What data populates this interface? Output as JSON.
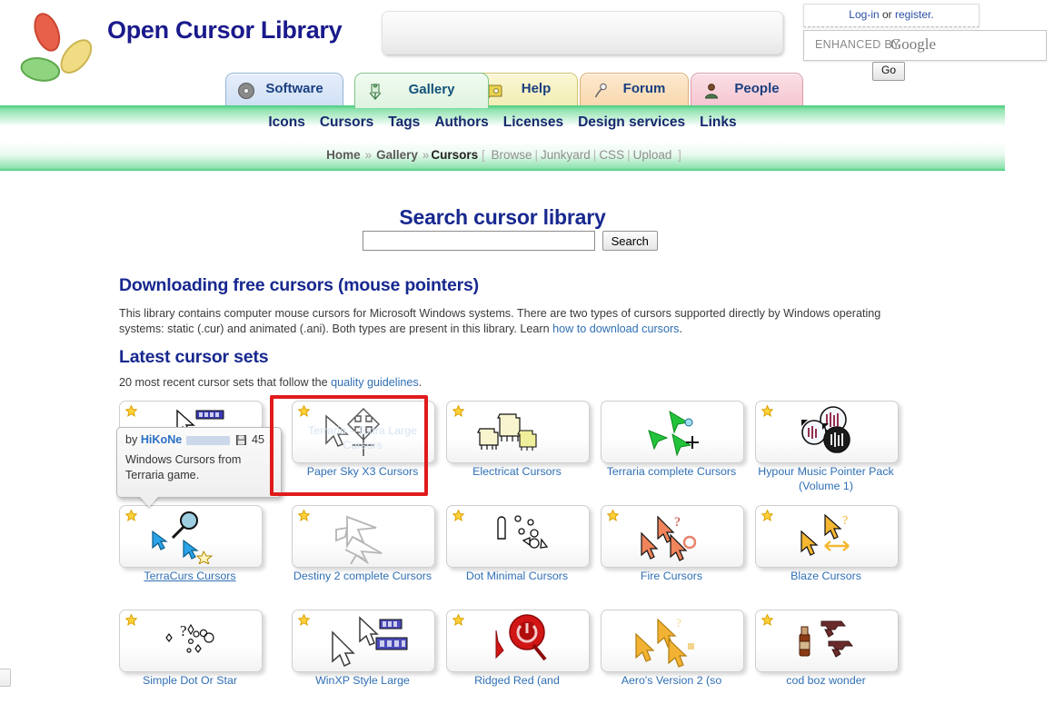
{
  "site": {
    "title": "Open Cursor Library",
    "logo_icon": "three-loop-logo"
  },
  "account": {
    "login_label": "Log-in",
    "or_label": " or ",
    "register_label": "register.",
    "google_enhanced_prefix": "ENHANCED BY",
    "google_brand": "Google",
    "go_label": "Go"
  },
  "tabs": [
    {
      "label": "Software",
      "icon": "disc-icon",
      "active": false
    },
    {
      "label": "Gallery",
      "icon": "easel-icon",
      "active": true
    },
    {
      "label": "Help",
      "icon": "book-icon",
      "active": false
    },
    {
      "label": "Forum",
      "icon": "microphone-icon",
      "active": false
    },
    {
      "label": "People",
      "icon": "person-icon",
      "active": false
    }
  ],
  "nav": [
    "Icons",
    "Cursors",
    "Tags",
    "Authors",
    "Licenses",
    "Design services",
    "Links"
  ],
  "breadcrumb": {
    "home": "Home",
    "gallery": "Gallery",
    "current": "Cursors",
    "open_bracket": "[",
    "close_bracket": "]",
    "pipe": "|",
    "sep": "»",
    "sub": [
      "Browse",
      "Junkyard",
      "CSS",
      "Upload"
    ]
  },
  "search": {
    "heading": "Search cursor library",
    "value": "",
    "placeholder": "",
    "button": "Search"
  },
  "intro": {
    "heading": "Downloading free cursors (mouse pointers)",
    "text_1": "This library contains computer mouse cursors for Microsoft Windows systems. There are two types of cursors supported directly by Windows operating systems: static (.cur) and animated (.ani). Both types are present in this library. Learn ",
    "link": "how to download cursors",
    "text_2": "."
  },
  "latest": {
    "heading": "Latest cursor sets",
    "sub_1": "20 most recent cursor sets that follow the ",
    "sub_link": "quality guidelines",
    "sub_2": "."
  },
  "tooltip": {
    "by_label": "by ",
    "author": "HiKoNe",
    "size": "45",
    "disk_icon": "floppy-disk-icon",
    "description": "Windows Cursors from Terraria game.",
    "ghost_caption": "Terraria – Extra Large Cursors"
  },
  "highlight": {
    "color": "#e01b1b",
    "target": "Paper Sky X3 Cursors"
  },
  "cards": [
    [
      {
        "title": "",
        "starred": true,
        "art": "arrow-and-blue-bar",
        "hover": false
      },
      {
        "title": "Paper Sky X3 Cursors",
        "starred": true,
        "art": "paper-sky",
        "hover": false
      },
      {
        "title": "Electricat Cursors",
        "starred": true,
        "art": "cats",
        "hover": false
      },
      {
        "title": "Terraria complete Cursors",
        "starred": false,
        "art": "green-arrows",
        "hover": false
      },
      {
        "title": "Hypour Music Pointer Pack (Volume 1)",
        "starred": true,
        "art": "music-discs",
        "hover": false
      }
    ],
    [
      {
        "title": "TerraCurs Cursors",
        "starred": true,
        "art": "blue-arrows-magnifier",
        "hover": true
      },
      {
        "title": "Destiny 2 complete Cursors",
        "starred": true,
        "art": "grey-angular",
        "hover": false
      },
      {
        "title": "Dot Minimal Cursors",
        "starred": true,
        "art": "dots",
        "hover": false
      },
      {
        "title": "Fire Cursors",
        "starred": true,
        "art": "orange-arrows",
        "hover": false
      },
      {
        "title": "Blaze Cursors",
        "starred": true,
        "art": "yellow-arrows",
        "hover": false
      }
    ],
    [
      {
        "title": "Simple Dot Or Star",
        "starred": true,
        "art": "stars-dots",
        "hover": false
      },
      {
        "title": "WinXP Style Large",
        "starred": true,
        "art": "winxp-arrows",
        "hover": false
      },
      {
        "title": "Ridged Red (and",
        "starred": true,
        "art": "red-target",
        "hover": false
      },
      {
        "title": "Aero's Version 2 (so",
        "starred": false,
        "art": "gold-arrows",
        "hover": false
      },
      {
        "title": "cod boz wonder",
        "starred": true,
        "art": "guns",
        "hover": false
      }
    ]
  ]
}
